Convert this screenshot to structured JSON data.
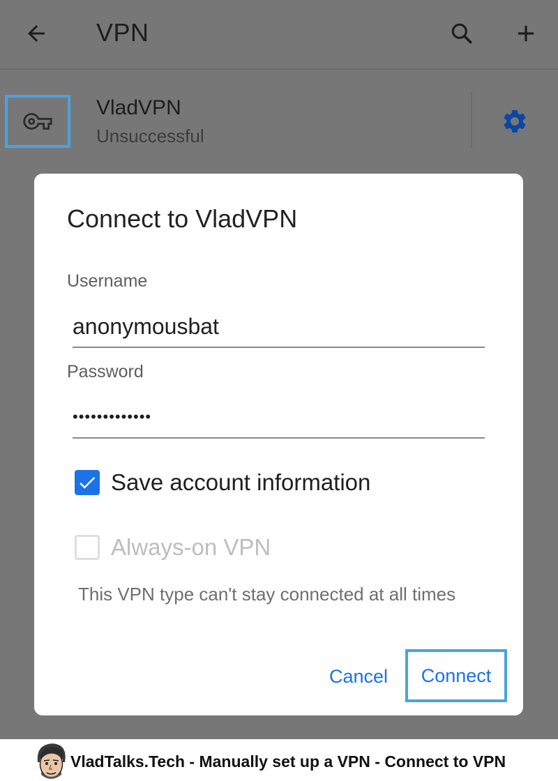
{
  "app_bar": {
    "title": "VPN",
    "icons": {
      "back": "arrow-left-icon",
      "search": "search-icon",
      "add": "plus-icon"
    }
  },
  "vpn_list": [
    {
      "name": "VladVPN",
      "status": "Unsuccessful",
      "icon": "key-icon",
      "settings_icon": "gear-icon"
    }
  ],
  "dialog": {
    "title": "Connect to VladVPN",
    "username_label": "Username",
    "username_value": "anonymousbat",
    "password_label": "Password",
    "password_value": "•••••••••••••",
    "save_account": {
      "label": "Save account information",
      "checked": true
    },
    "always_on": {
      "label": "Always-on VPN",
      "checked": false,
      "disabled": true
    },
    "always_on_note": "This VPN type can't stay connected at all times",
    "cancel_label": "Cancel",
    "connect_label": "Connect"
  },
  "footer": {
    "caption": "VladTalks.Tech - Manually set up a VPN - Connect to VPN"
  },
  "colors": {
    "accent": "#1a73e8",
    "highlight_border": "#4aa3df",
    "scrim": "#777777"
  }
}
